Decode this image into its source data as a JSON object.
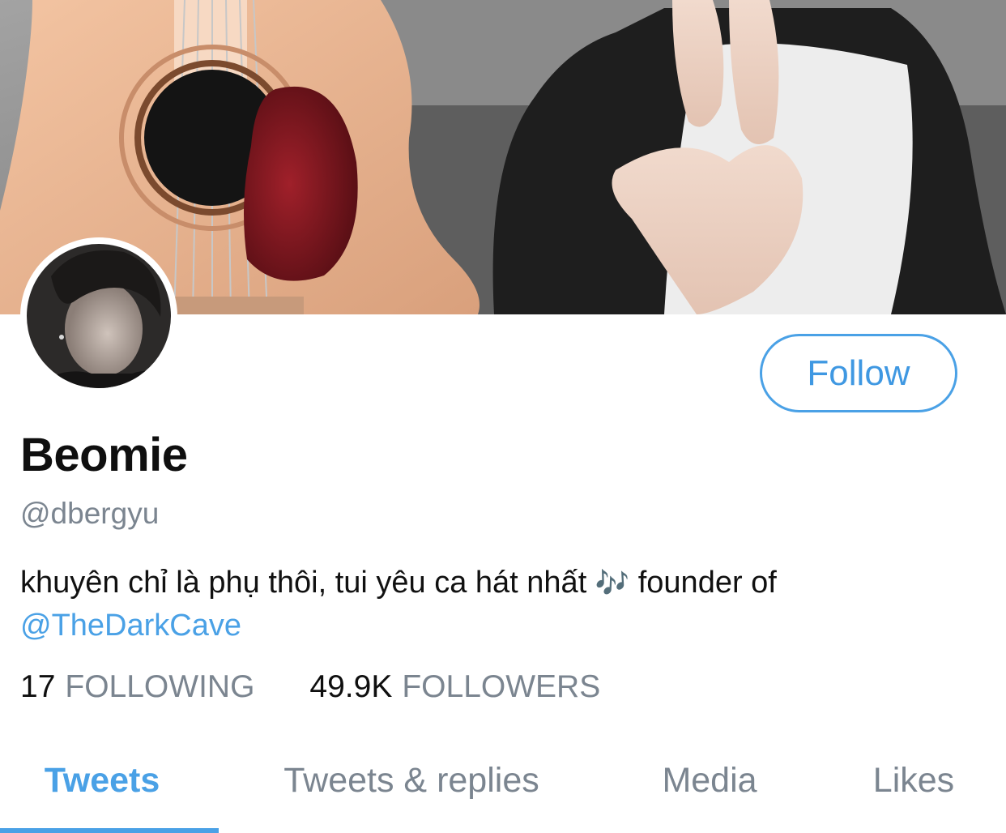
{
  "profile": {
    "display_name": "Beomie",
    "handle": "@dbergyu",
    "bio_text": "khuyên chỉ là phụ thôi, tui yêu ca hát nhất",
    "bio_notes": "🎶",
    "bio_tail": "founder of",
    "bio_mention": "@TheDarkCave"
  },
  "actions": {
    "follow_label": "Follow"
  },
  "stats": {
    "following_count": "17",
    "following_label": "FOLLOWING",
    "followers_count": "49.9K",
    "followers_label": "FOLLOWERS"
  },
  "tabs": [
    {
      "label": "Tweets",
      "active": true
    },
    {
      "label": "Tweets & replies",
      "active": false
    },
    {
      "label": "Media",
      "active": false
    },
    {
      "label": "Likes",
      "active": false
    }
  ],
  "colors": {
    "accent": "#4aa1e6",
    "muted": "#7b8590",
    "text": "#0f0f0f"
  }
}
